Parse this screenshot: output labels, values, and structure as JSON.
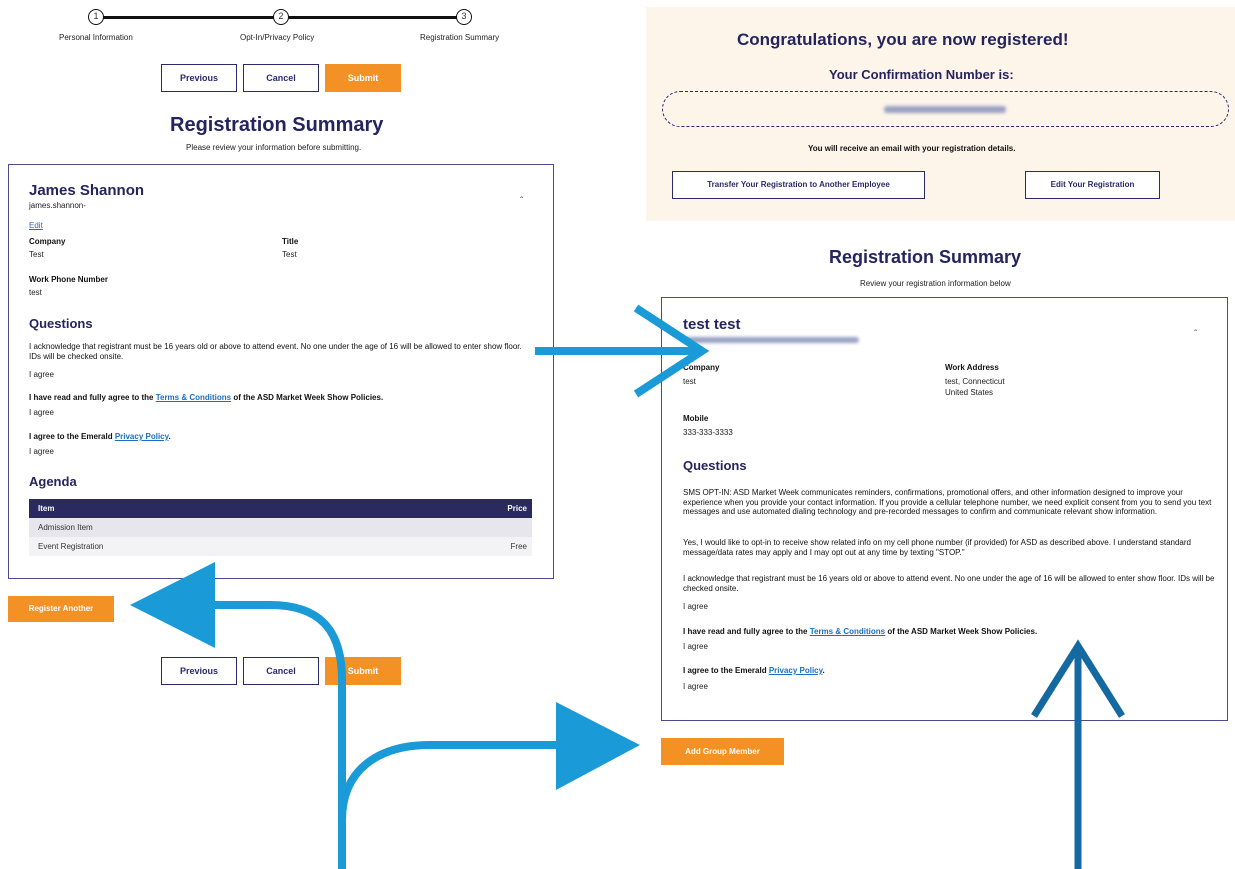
{
  "left": {
    "steps": [
      {
        "num": "1",
        "label": "Personal Information"
      },
      {
        "num": "2",
        "label": "Opt-In/Privacy Policy"
      },
      {
        "num": "3",
        "label": "Registration Summary"
      }
    ],
    "buttons": {
      "previous": "Previous",
      "cancel": "Cancel",
      "submit": "Submit"
    },
    "title": "Registration Summary",
    "subtitle": "Please review your information before submitting.",
    "person": {
      "name": "James Shannon",
      "email": "james.shannon-",
      "edit": "Edit",
      "company_label": "Company",
      "company": "Test",
      "title_label": "Title",
      "title": "Test",
      "phone_label": "Work Phone Number",
      "phone": "test"
    },
    "questions_heading": "Questions",
    "q1": "I acknowledge that registrant must be 16 years old or above to attend event. No one under the age of 16 will be allowed to enter show floor. IDs will be checked onsite.",
    "q1_answer": "I agree",
    "q2_pre": "I have read and fully agree to the ",
    "q2_link": "Terms & Conditions",
    "q2_post": " of the ASD Market Week Show Policies.",
    "q2_answer": "I agree",
    "q3_pre": "I agree to the Emerald ",
    "q3_link": "Privacy Policy",
    "q3_post": ".",
    "q3_answer": "I agree",
    "agenda_heading": "Agenda",
    "agenda_columns": [
      "Item",
      "Price"
    ],
    "agenda_rows": [
      {
        "item": "Admission Item",
        "price": ""
      },
      {
        "item": "Event Registration",
        "price": "Free"
      }
    ],
    "register_another": "Register Another"
  },
  "right": {
    "congrats_title": "Congratulations, you are now registered!",
    "confirmation_label": "Your Confirmation Number is:",
    "email_note": "You will receive an email with your registration details.",
    "transfer_button": "Transfer Your Registration to Another Employee",
    "edit_button": "Edit Your Registration",
    "title": "Registration Summary",
    "subtitle": "Review your registration information below",
    "person": {
      "name": "test test",
      "company_label": "Company",
      "company": "test",
      "address_label": "Work Address",
      "address_line1": "test, Connecticut",
      "address_line2": "United States",
      "mobile_label": "Mobile",
      "mobile": "333-333-3333"
    },
    "questions_heading": "Questions",
    "sms": "SMS OPT-IN: ASD Market Week communicates reminders, confirmations, promotional offers, and other information designed to improve your experience when you provide your contact information. If you provide a cellular telephone number, we need explicit consent from you to send you text messages and use automated dialing technology and pre-recorded messages to confirm and communicate relevant show information.",
    "sms_yes": "Yes, I would like to opt-in to receive show related info on my cell phone number (if provided) for ASD as described above. I understand standard message/data rates may apply and I may opt out at any time by texting \"STOP.\"",
    "q1": "I acknowledge that registrant must be 16 years old or above to attend event. No one under the age of 16 will be allowed to enter show floor. IDs will be checked onsite.",
    "q1_answer": "I agree",
    "q2_pre": "I have read and fully agree to the ",
    "q2_link": "Terms & Conditions",
    "q2_post": " of the ASD Market Week Show Policies.",
    "q2_answer": "I agree",
    "q3_pre": "I agree to the Emerald ",
    "q3_link": "Privacy Policy",
    "q3_post": ".",
    "q3_answer": "I agree",
    "add_group_member": "Add Group Member"
  },
  "colors": {
    "navy": "#24245e",
    "orange": "#f39125",
    "arrow_light": "#1b9ad8",
    "arrow_dark": "#146aa0",
    "link": "#1a6fc4",
    "congrats_bg": "#fdf4ea"
  }
}
